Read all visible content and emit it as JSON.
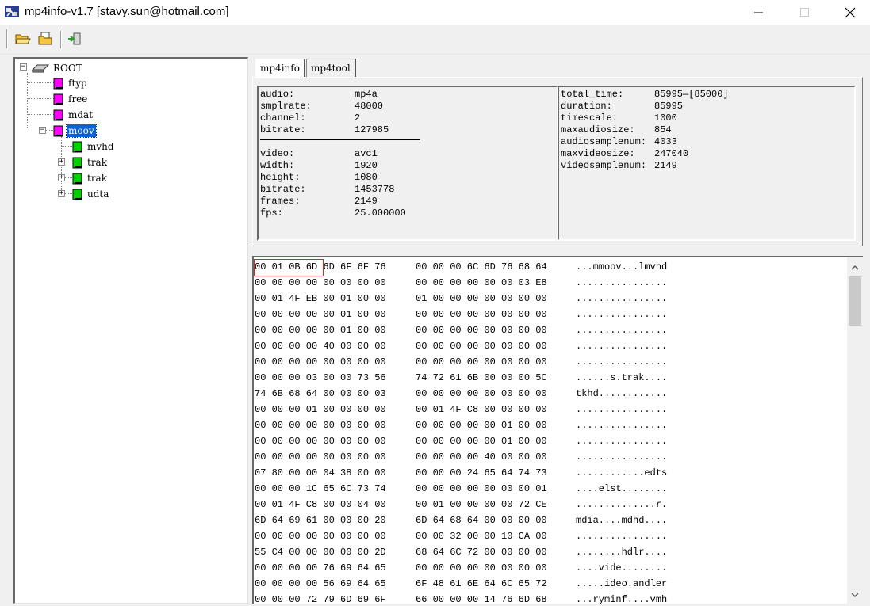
{
  "window": {
    "title": "mp4info-v1.7 [stavy.sun@hotmail.com]",
    "minimize_glyph": "—",
    "maximize_glyph": "☐",
    "close_glyph": "✕"
  },
  "toolbar": {
    "buttons": [
      {
        "name": "open-folder-icon"
      },
      {
        "name": "open-file-icon"
      },
      {
        "name": "exit-icon"
      }
    ]
  },
  "tree": {
    "root": "ROOT",
    "nodes": [
      {
        "label": "ftyp",
        "color": "#ff00ff"
      },
      {
        "label": "free",
        "color": "#ff00ff"
      },
      {
        "label": "mdat",
        "color": "#ff00ff"
      },
      {
        "label": "moov",
        "color": "#ff00ff",
        "selected": true
      },
      {
        "label": "mvhd",
        "color": "#00c800"
      },
      {
        "label": "trak",
        "color": "#00c800"
      },
      {
        "label": "trak",
        "color": "#00c800"
      },
      {
        "label": "udta",
        "color": "#00c800"
      }
    ]
  },
  "tabs": [
    {
      "label": "mp4info",
      "active": true
    },
    {
      "label": "mp4tool",
      "active": false
    }
  ],
  "info_left": {
    "audio": [
      {
        "key": "audio:",
        "value": "mp4a"
      },
      {
        "key": "smplrate:",
        "value": "48000"
      },
      {
        "key": "channel:",
        "value": "2"
      },
      {
        "key": "bitrate:",
        "value": "127985"
      }
    ],
    "video": [
      {
        "key": "video:",
        "value": "avc1"
      },
      {
        "key": "width:",
        "value": "1920"
      },
      {
        "key": "height:",
        "value": "1080"
      },
      {
        "key": "bitrate:",
        "value": "1453778"
      },
      {
        "key": "frames:",
        "value": "2149"
      },
      {
        "key": "fps:",
        "value": "25.000000"
      }
    ]
  },
  "info_right": [
    {
      "key": "total_time:",
      "value": "85995—[85000]"
    },
    {
      "key": "duration:",
      "value": "85995"
    },
    {
      "key": "timescale:",
      "value": "1000"
    },
    {
      "key": "maxaudiosize:",
      "value": "854"
    },
    {
      "key": "audiosamplenum:",
      "value": "4033"
    },
    {
      "key": "maxvideosize:",
      "value": "247040"
    },
    {
      "key": "videosamplenum:",
      "value": "2149"
    }
  ],
  "hex_rows": [
    {
      "a": "00 01 0B 6D 6D 6F 6F 76",
      "b": "00 00 00 6C 6D 76 68 64",
      "c": "...mmoov...lmvhd"
    },
    {
      "a": "00 00 00 00 00 00 00 00",
      "b": "00 00 00 00 00 00 03 E8",
      "c": "................"
    },
    {
      "a": "00 01 4F EB 00 01 00 00",
      "b": "01 00 00 00 00 00 00 00",
      "c": "................"
    },
    {
      "a": "00 00 00 00 00 01 00 00",
      "b": "00 00 00 00 00 00 00 00",
      "c": "................"
    },
    {
      "a": "00 00 00 00 00 01 00 00",
      "b": "00 00 00 00 00 00 00 00",
      "c": "................"
    },
    {
      "a": "00 00 00 00 40 00 00 00",
      "b": "00 00 00 00 00 00 00 00",
      "c": "................"
    },
    {
      "a": "00 00 00 00 00 00 00 00",
      "b": "00 00 00 00 00 00 00 00",
      "c": "................"
    },
    {
      "a": "00 00 00 03 00 00 73 56",
      "b": "74 72 61 6B 00 00 00 5C",
      "c": "......s.trak...."
    },
    {
      "a": "74 6B 68 64 00 00 00 03",
      "b": "00 00 00 00 00 00 00 00",
      "c": "tkhd............"
    },
    {
      "a": "00 00 00 01 00 00 00 00",
      "b": "00 01 4F C8 00 00 00 00",
      "c": "................"
    },
    {
      "a": "00 00 00 00 00 00 00 00",
      "b": "00 00 00 00 00 01 00 00",
      "c": "................"
    },
    {
      "a": "00 00 00 00 00 00 00 00",
      "b": "00 00 00 00 00 01 00 00",
      "c": "................"
    },
    {
      "a": "00 00 00 00 00 00 00 00",
      "b": "00 00 00 00 40 00 00 00",
      "c": "................"
    },
    {
      "a": "07 80 00 00 04 38 00 00",
      "b": "00 00 00 24 65 64 74 73",
      "c": "............edts"
    },
    {
      "a": "00 00 00 1C 65 6C 73 74",
      "b": "00 00 00 00 00 00 00 01",
      "c": "....elst........"
    },
    {
      "a": "00 01 4F C8 00 00 04 00",
      "b": "00 01 00 00 00 00 72 CE",
      "c": "..............r."
    },
    {
      "a": "6D 64 69 61 00 00 00 20",
      "b": "6D 64 68 64 00 00 00 00",
      "c": "mdia....mdhd...."
    },
    {
      "a": "00 00 00 00 00 00 00 00",
      "b": "00 00 32 00 00 10 CA 00",
      "c": "................"
    },
    {
      "a": "55 C4 00 00 00 00 00 2D",
      "b": "68 64 6C 72 00 00 00 00",
      "c": "........hdlr...."
    },
    {
      "a": "00 00 00 00 76 69 64 65",
      "b": "00 00 00 00 00 00 00 00",
      "c": "....vide........"
    },
    {
      "a": "00 00 00 00 56 69 64 65",
      "b": "6F 48 61 6E 64 6C 65 72",
      "c": ".....ideo.andler"
    },
    {
      "a": "00 00 00 72 79 6D 69 6F",
      "b": "66 00 00 00 14 76 6D 68",
      "c": "...ryminf....vmh"
    }
  ]
}
